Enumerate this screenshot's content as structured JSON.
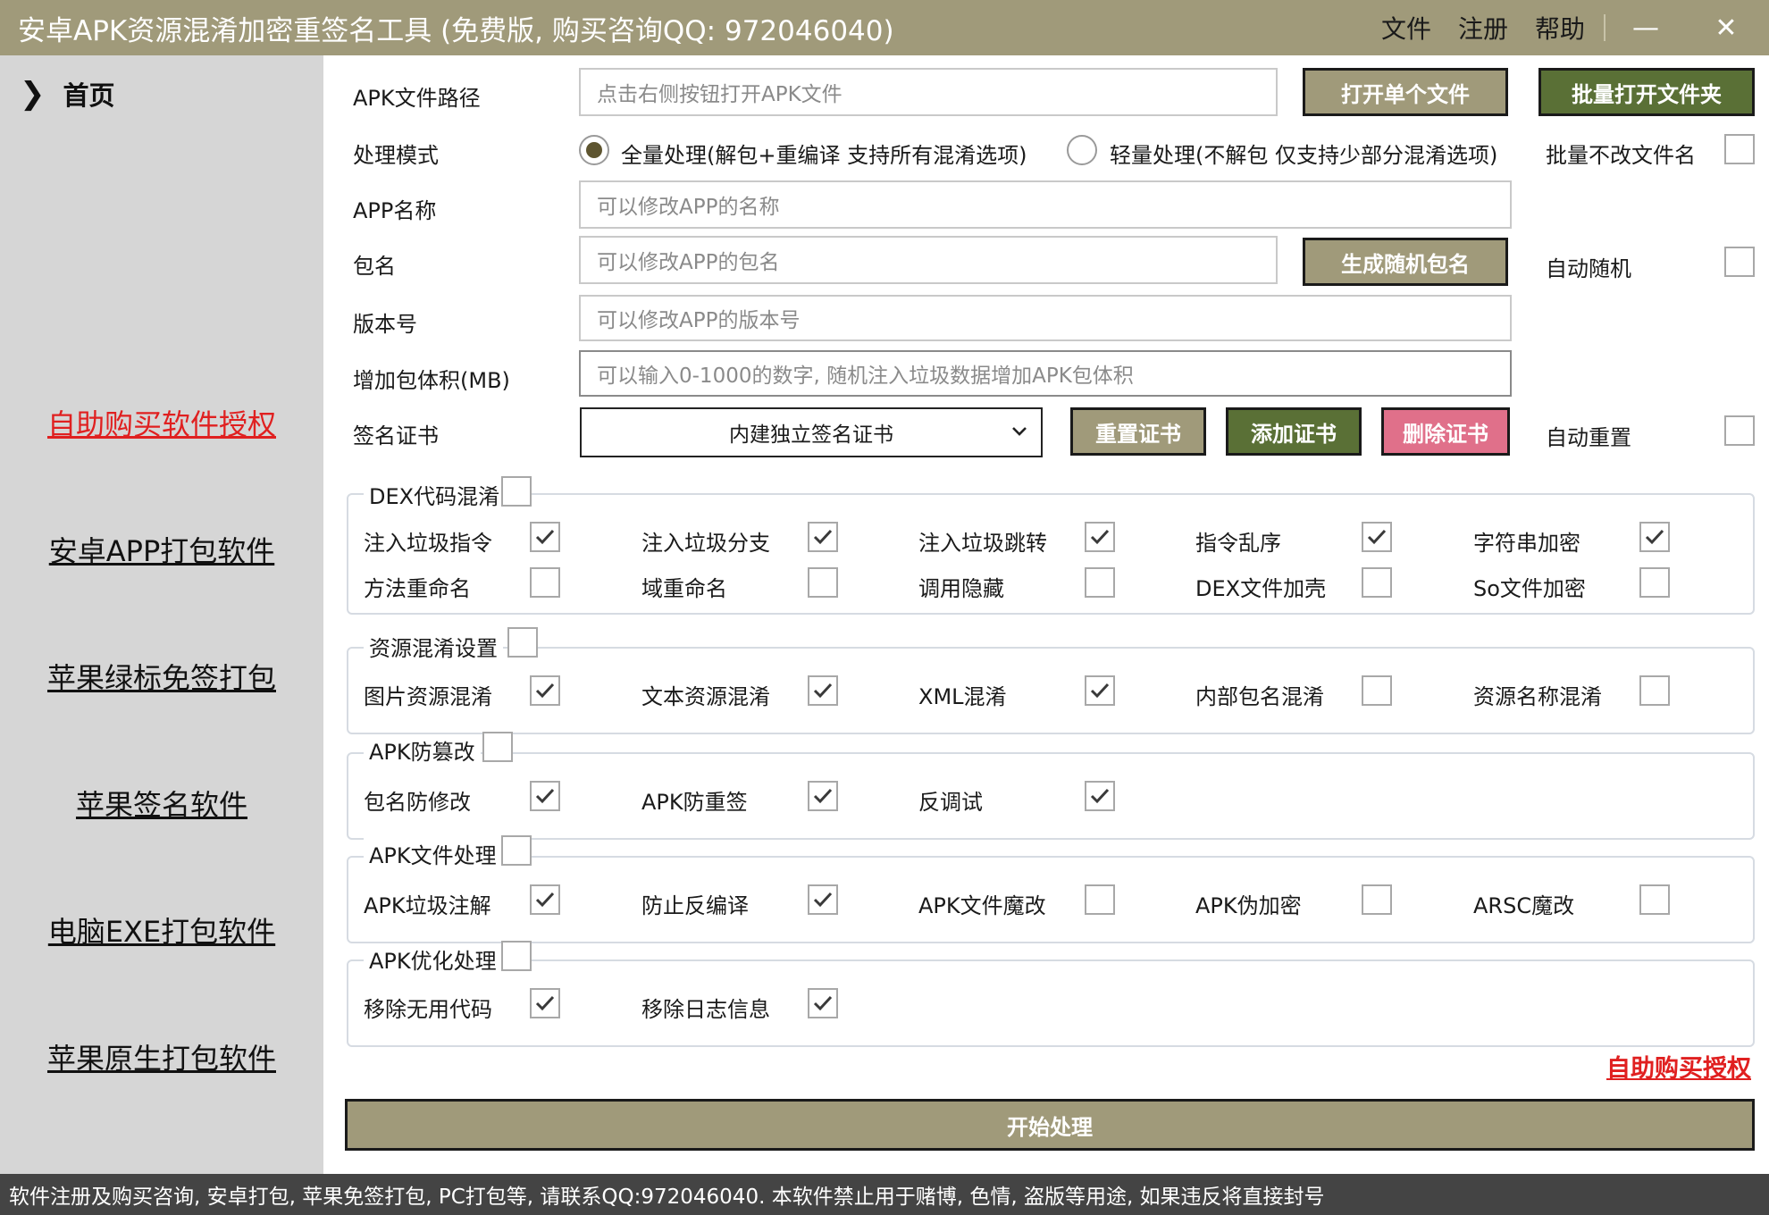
{
  "window": {
    "title": "安卓APK资源混淆加密重签名工具 (免费版, 购买咨询QQ: 972046040)",
    "menu": [
      "文件",
      "注册",
      "帮助"
    ],
    "minimize": "—",
    "close": "✕"
  },
  "sidebar": {
    "home": "首页",
    "links": [
      "自助购买软件授权",
      "安卓APP打包软件",
      "苹果绿标免签打包",
      "苹果签名软件",
      "电脑EXE打包软件",
      "苹果原生打包软件"
    ]
  },
  "form": {
    "apk_path_label": "APK文件路径",
    "apk_path_placeholder": "点击右侧按钮打开APK文件",
    "open_single": "打开单个文件",
    "batch_open": "批量打开文件夹",
    "mode_label": "处理模式",
    "mode_full": "全量处理(解包+重编译 支持所有混淆选项)",
    "mode_light": "轻量处理(不解包 仅支持少部分混淆选项)",
    "batch_keep_name": "批量不改文件名",
    "app_name_label": "APP名称",
    "app_name_placeholder": "可以修改APP的名称",
    "package_label": "包名",
    "package_placeholder": "可以修改APP的包名",
    "gen_package": "生成随机包名",
    "auto_random": "自动随机",
    "version_label": "版本号",
    "version_placeholder": "可以修改APP的版本号",
    "size_label": "增加包体积(MB)",
    "size_placeholder": "可以输入0-1000的数字, 随机注入垃圾数据增加APK包体积",
    "cert_label": "签名证书",
    "cert_value": "内建独立签名证书",
    "reset_cert": "重置证书",
    "add_cert": "添加证书",
    "delete_cert": "删除证书",
    "auto_reset": "自动重置"
  },
  "groups": {
    "dex": {
      "title": "DEX代码混淆",
      "items": [
        {
          "label": "注入垃圾指令",
          "checked": true
        },
        {
          "label": "注入垃圾分支",
          "checked": true
        },
        {
          "label": "注入垃圾跳转",
          "checked": true
        },
        {
          "label": "指令乱序",
          "checked": true
        },
        {
          "label": "字符串加密",
          "checked": true
        },
        {
          "label": "方法重命名",
          "checked": false
        },
        {
          "label": "域重命名",
          "checked": false
        },
        {
          "label": "调用隐藏",
          "checked": false
        },
        {
          "label": "DEX文件加壳",
          "checked": false
        },
        {
          "label": "So文件加密",
          "checked": false
        }
      ]
    },
    "res": {
      "title": "资源混淆设置",
      "items": [
        {
          "label": "图片资源混淆",
          "checked": true
        },
        {
          "label": "文本资源混淆",
          "checked": true
        },
        {
          "label": "XML混淆",
          "checked": true
        },
        {
          "label": "内部包名混淆",
          "checked": false
        },
        {
          "label": "资源名称混淆",
          "checked": false
        }
      ]
    },
    "tamper": {
      "title": "APK防篡改",
      "items": [
        {
          "label": "包名防修改",
          "checked": true
        },
        {
          "label": "APK防重签",
          "checked": true
        },
        {
          "label": "反调试",
          "checked": true
        }
      ]
    },
    "file": {
      "title": "APK文件处理",
      "items": [
        {
          "label": "APK垃圾注解",
          "checked": true
        },
        {
          "label": "防止反编译",
          "checked": true
        },
        {
          "label": "APK文件魔改",
          "checked": false
        },
        {
          "label": "APK伪加密",
          "checked": false
        },
        {
          "label": "ARSC魔改",
          "checked": false
        }
      ]
    },
    "opt": {
      "title": "APK优化处理",
      "items": [
        {
          "label": "移除无用代码",
          "checked": true
        },
        {
          "label": "移除日志信息",
          "checked": true
        }
      ]
    }
  },
  "buy_link": "自助购买授权",
  "start": "开始处理",
  "status": "软件注册及购买咨询, 安卓打包, 苹果免签打包, PC打包等, 请联系QQ:972046040.  本软件禁止用于赌博, 色情, 盗版等用途, 如果违反将直接封号"
}
